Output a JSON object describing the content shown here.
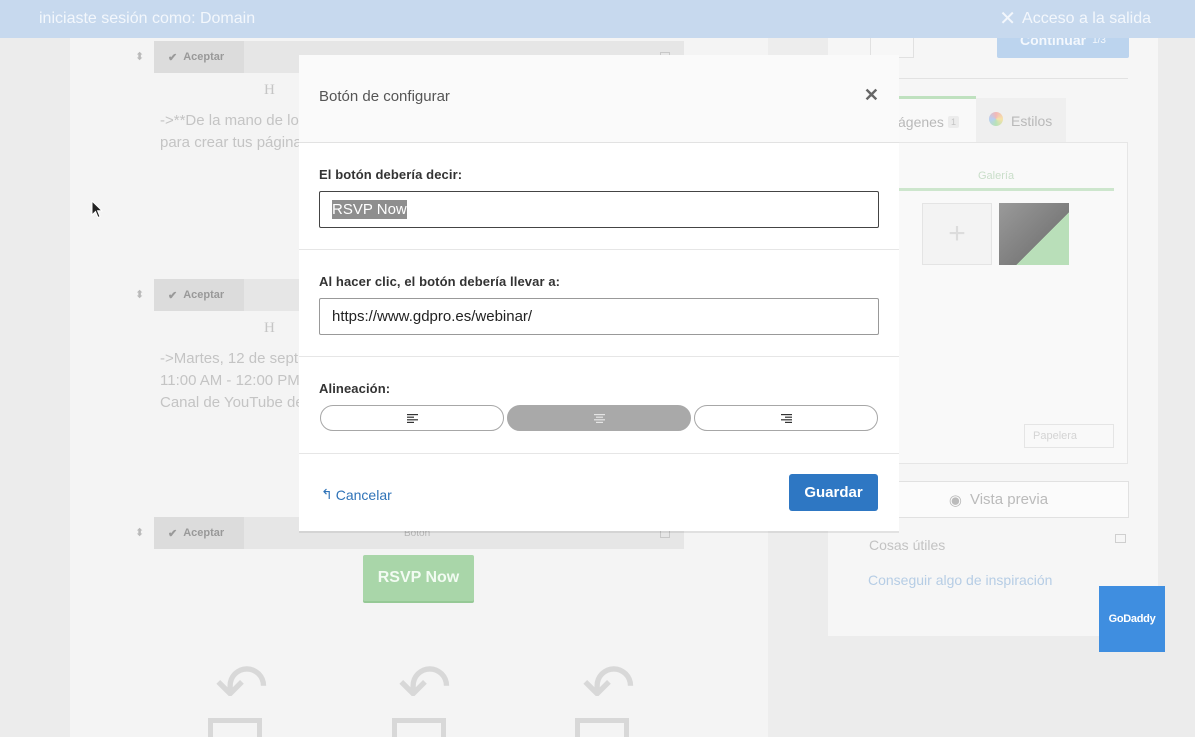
{
  "topbar": {
    "session_text": "iniciaste sesión como: Domain",
    "exit_label": "Acceso a la salida"
  },
  "background": {
    "block_accept_label": "Aceptar",
    "block3_type_label": "Botón",
    "block1_text": "->**De la mano de lo\npara crear tus página",
    "block2_text": "->Martes, 12 de sept\n11:00 AM - 12:00 PM\nCanal de YouTube de",
    "rsvp_ghost_label": "RSVP Now",
    "continue_label": "Continuar",
    "continue_page": "1/3",
    "tab_images": "ágenes",
    "tab_images_count": "1",
    "tab_styles": "Estilos",
    "gallery_label": "Galería",
    "trash_label": "Papelera",
    "preview_label": "Vista previa",
    "useful_label": "Cosas útiles",
    "inspiration_label": "Conseguir algo de inspiración"
  },
  "modal": {
    "title": "Botón de configurar",
    "button_text_label": "El botón debería decir:",
    "button_text_value": "RSVP Now",
    "link_label": "Al hacer clic, el botón debería llevar a:",
    "link_value": "https://www.gdpro.es/webinar/",
    "alignment_label": "Alineación:",
    "alignment_options": [
      "left",
      "center",
      "right"
    ],
    "alignment_selected": "center",
    "cancel_label": "Cancelar",
    "save_label": "Guardar"
  },
  "badge": {
    "label": "GoDaddy"
  },
  "colors": {
    "primary": "#2e77c3",
    "link": "#2f73b8",
    "topbar": "#c7d9ee"
  }
}
